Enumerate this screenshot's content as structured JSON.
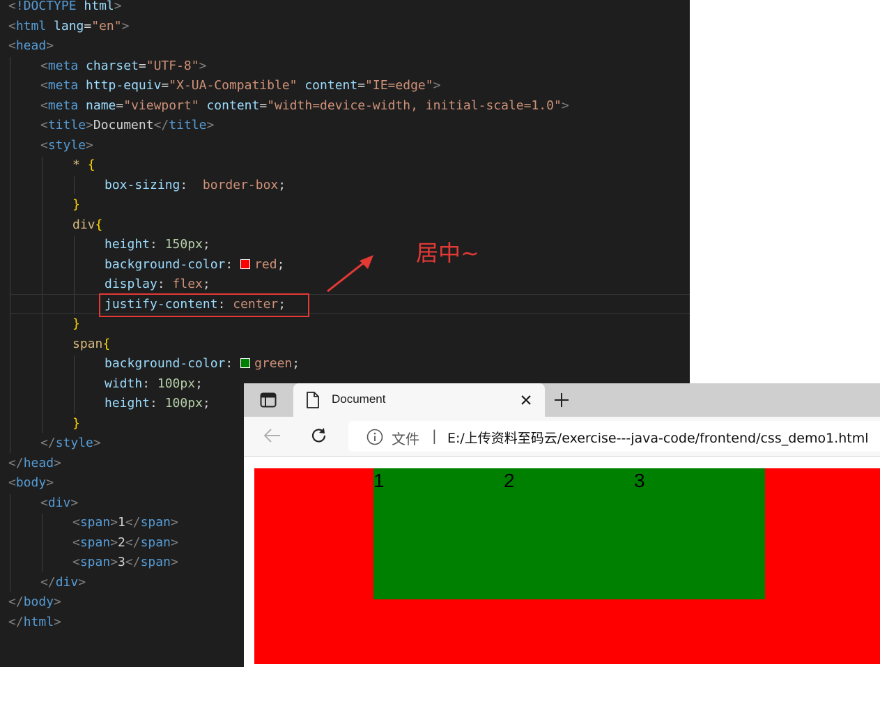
{
  "editor": {
    "annotation": "居中~",
    "swatch_colors": {
      "red": "#ff0000",
      "green": "#008000"
    }
  },
  "code": {
    "doctype": "!DOCTYPE",
    "html_kw": "html",
    "lang_attr": "lang",
    "lang_val": "\"en\"",
    "head": "head",
    "meta": "meta",
    "charset_attr": "charset",
    "charset_val": "\"UTF-8\"",
    "http_equiv_attr": "http-equiv",
    "http_equiv_val": "\"X-UA-Compatible\"",
    "content_attr": "content",
    "ie_val": "\"IE=edge\"",
    "name_attr": "name",
    "viewport_val": "\"viewport\"",
    "viewport_content_val": "\"width=device-width, initial-scale=1.0\"",
    "title_tag": "title",
    "title_text": "Document",
    "style_tag": "style",
    "star_sel": "*",
    "box_sizing_prop": "box-sizing",
    "box_sizing_val": "border-box",
    "div_sel": "div",
    "height_prop": "height",
    "val_150px": "150px",
    "bg_color_prop": "background-color",
    "red_val": "red",
    "display_prop": "display",
    "flex_val": "flex",
    "justify_prop": "justify-content",
    "center_val": "center",
    "span_sel": "span",
    "green_val": "green",
    "width_prop": "width",
    "val_100px": "100px",
    "body_tag": "body",
    "div_tag": "div",
    "span_tag": "span",
    "span1": "1",
    "span2": "2",
    "span3": "3"
  },
  "browser": {
    "tab_title": "Document",
    "url_scheme": "文件",
    "url_separator": "|",
    "url": "E:/上传资料至码云/exercise---java-code/frontend/css_demo1.html",
    "spans": [
      "1",
      "2",
      "3"
    ],
    "demo_colors": {
      "div": "#ff0000",
      "span": "#008000"
    },
    "icons": [
      "tab-actions-icon",
      "file-icon",
      "close-icon",
      "plus-icon",
      "back-arrow-icon",
      "reload-icon",
      "info-icon"
    ]
  }
}
